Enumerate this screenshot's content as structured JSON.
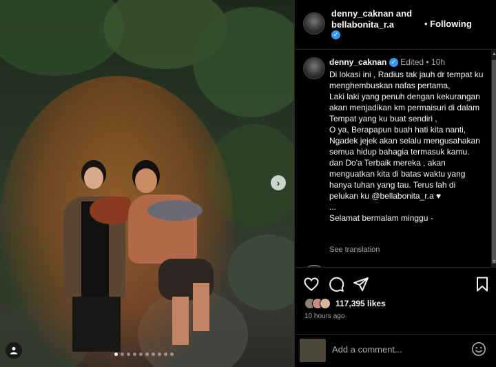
{
  "photo": {
    "next_arrow": "›",
    "carousel_count": 10,
    "carousel_active_index": 0
  },
  "header": {
    "username_1": "denny_caknan and",
    "username_2": "bellabonita_r.a",
    "follow_label": "• Following"
  },
  "caption": {
    "username": "denny_caknan",
    "edited": "Edited •",
    "age": "10h",
    "lines": [
      "Di lokasi ini , Radius tak jauh dr tempat ku menghembuskan nafas pertama,",
      "Laki laki yang penuh dengan kekurangan akan menjadikan km permaisuri di dalam Tempat yang ku buat sendiri ,",
      "O ya, Berapapun buah hati kita nanti, Ngadek jejek akan selalu mengusahakan semua hidup bahagia termasuk kamu.",
      "dan Do'a Terbaik mereka , akan menguatkan kita di batas waktu yang hanya tuhan yang tau. Terus lah di pelukan ku @bellabonita_r.a ♥",
      "...",
      "Selamat bermalam minggu -"
    ],
    "see_translation": "See translation"
  },
  "actions": {
    "likes": "117,395 likes",
    "time_ago": "10 hours ago"
  },
  "comment_box": {
    "placeholder": "Add a comment..."
  },
  "icons": {
    "like": "heart-icon",
    "comment": "comment-icon",
    "share": "share-icon",
    "save": "bookmark-icon",
    "emoji": "emoji-icon"
  },
  "colors": {
    "background": "#000000",
    "verified": "#3897f0",
    "muted_text": "#a8a8a8",
    "divider": "#262626"
  }
}
